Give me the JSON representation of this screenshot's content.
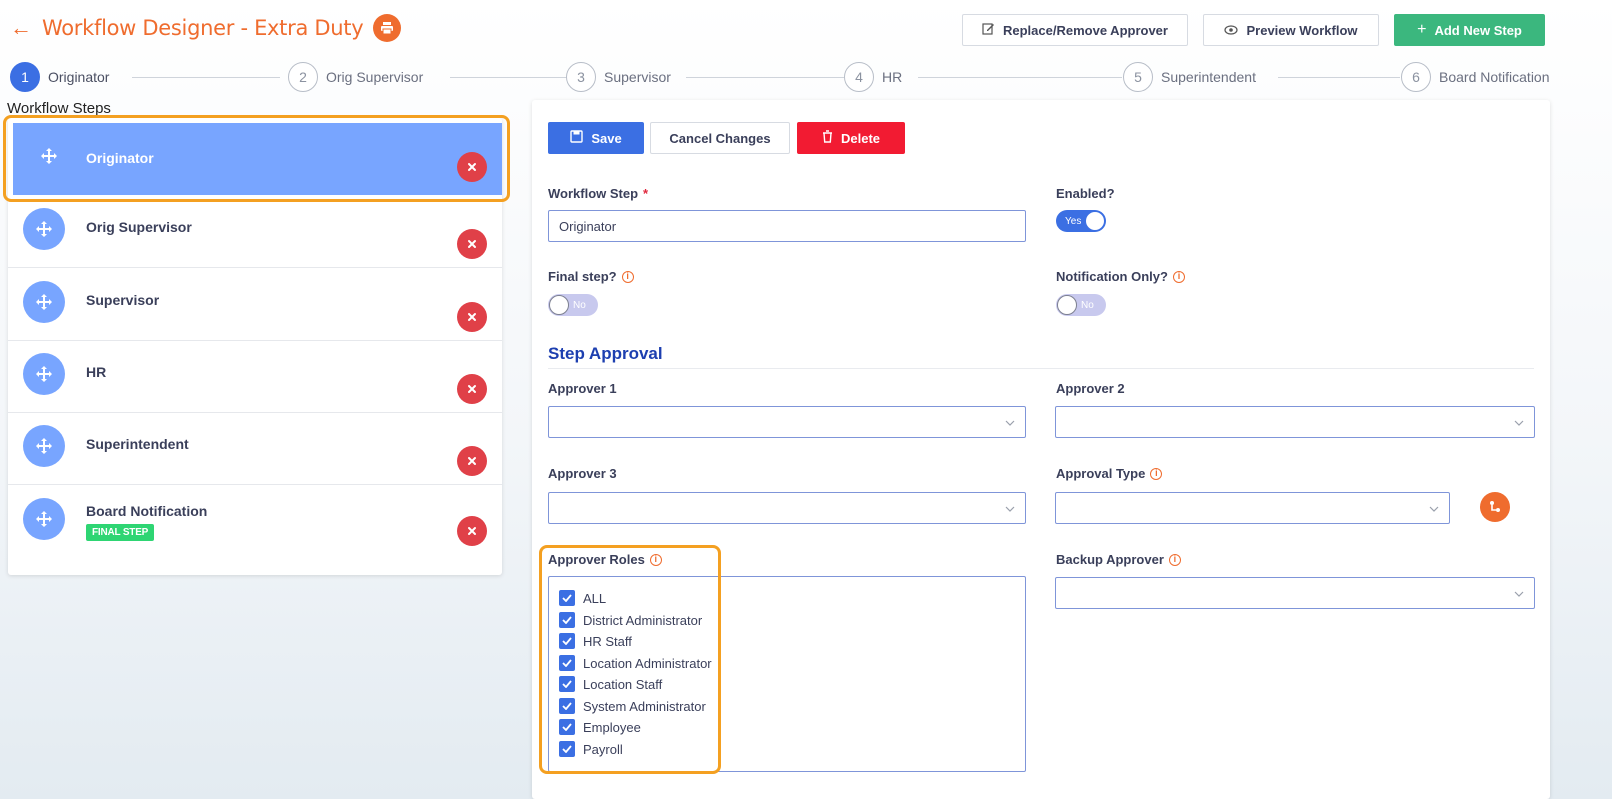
{
  "header": {
    "back_icon": "arrow-left-icon",
    "title": "Workflow Designer - Extra Duty",
    "print_icon": "print-icon",
    "buttons": {
      "replace": "Replace/Remove Approver",
      "preview": "Preview Workflow",
      "add": "Add New Step"
    },
    "accent_color": "#ef6c2e",
    "green_color": "#3bb77e"
  },
  "stepper": [
    {
      "num": "1",
      "label": "Originator",
      "active": true
    },
    {
      "num": "2",
      "label": "Orig Supervisor",
      "active": false
    },
    {
      "num": "3",
      "label": "Supervisor",
      "active": false
    },
    {
      "num": "4",
      "label": "HR",
      "active": false
    },
    {
      "num": "5",
      "label": "Superintendent",
      "active": false
    },
    {
      "num": "6",
      "label": "Board Notification",
      "active": false
    }
  ],
  "workflow_steps": {
    "title": "Workflow Steps",
    "items": [
      {
        "label": "Originator",
        "selected": true
      },
      {
        "label": "Orig Supervisor"
      },
      {
        "label": "Supervisor"
      },
      {
        "label": "HR"
      },
      {
        "label": "Superintendent"
      },
      {
        "label": "Board Notification",
        "badge": "FINAL STEP"
      }
    ]
  },
  "form": {
    "buttons": {
      "save": "Save",
      "cancel": "Cancel Changes",
      "delete": "Delete"
    },
    "workflow_step_label": "Workflow Step",
    "required_mark": "*",
    "workflow_step_value": "Originator",
    "enabled_label": "Enabled?",
    "enabled_value": "Yes",
    "final_step_label": "Final step?",
    "final_step_value": "No",
    "notification_only_label": "Notification Only?",
    "notification_only_value": "No",
    "section_title": "Step Approval",
    "approver1_label": "Approver 1",
    "approver2_label": "Approver 2",
    "approver3_label": "Approver 3",
    "approval_type_label": "Approval Type",
    "approver_roles_label": "Approver Roles",
    "backup_approver_label": "Backup Approver",
    "roles": [
      {
        "label": "ALL",
        "checked": true
      },
      {
        "label": "District Administrator",
        "checked": true
      },
      {
        "label": "HR Staff",
        "checked": true
      },
      {
        "label": "Location Administrator",
        "checked": true
      },
      {
        "label": "Location Staff",
        "checked": true
      },
      {
        "label": "System Administrator",
        "checked": true
      },
      {
        "label": "Employee",
        "checked": true
      },
      {
        "label": "Payroll",
        "checked": true
      }
    ]
  }
}
